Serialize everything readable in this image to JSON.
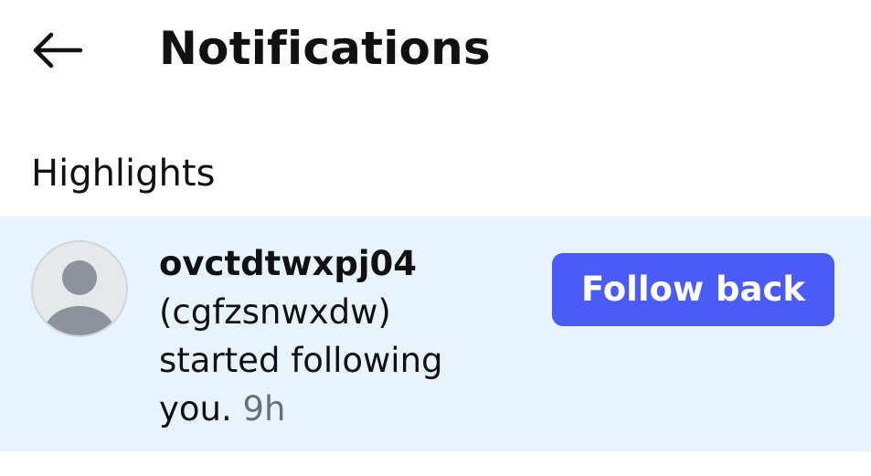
{
  "header": {
    "back_icon": "arrow-left-icon",
    "title": "Notifications"
  },
  "sections": [
    {
      "title": "Highlights",
      "notifications": [
        {
          "username": "ovctdtwxpj04",
          "display_name": "(cgfzsnwxdw)",
          "message_line1": "started following",
          "message_line2": "you.",
          "time": "9h",
          "action_label": "Follow back",
          "avatar_icon": "default-avatar-icon"
        }
      ]
    }
  ],
  "colors": {
    "highlight_background": "#e7f4fd",
    "follow_button": "#4b5bf5",
    "timestamp_text": "#6b7078"
  }
}
